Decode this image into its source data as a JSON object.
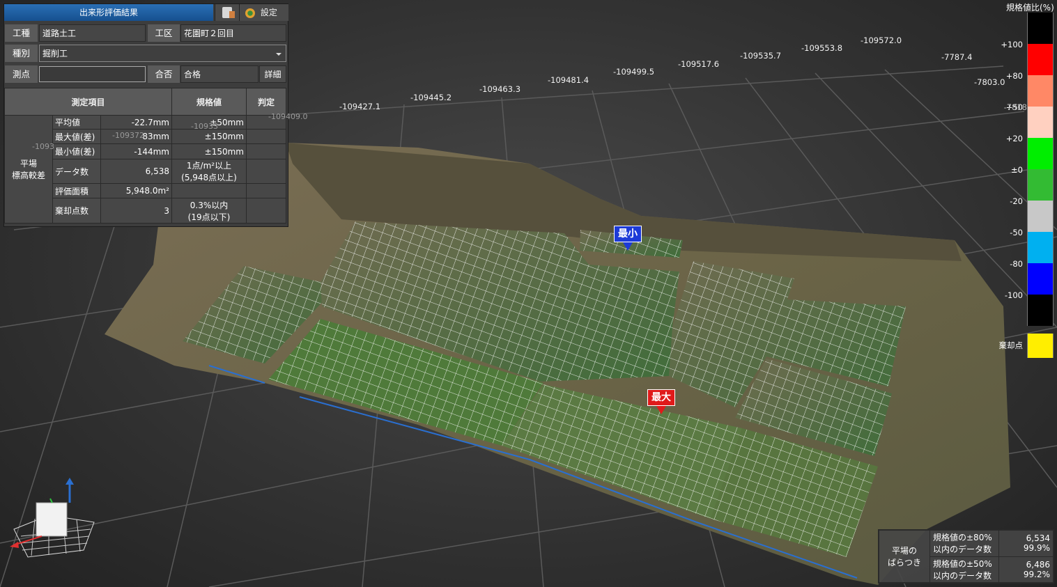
{
  "panel": {
    "title": "出来形評価結果",
    "settings_label": "設定",
    "clipboard_icon": "clipboard-icon",
    "settings_icon": "gear-icon",
    "work_type_label": "工種",
    "work_type_value": "道路土工",
    "section_label": "工区",
    "section_value": "花園町２回目",
    "category_label": "種別",
    "category_value": "掘削工",
    "point_label": "測点",
    "point_value": "",
    "pass_label": "合否",
    "pass_value": "合格",
    "detail_label": "詳細",
    "table_headers": {
      "item": "測定項目",
      "spec": "規格値",
      "judge": "判定"
    },
    "group_label_1": "平場",
    "group_label_2": "標高較差",
    "rows": [
      {
        "label": "平均値",
        "value": "-22.7mm",
        "spec": "±50mm",
        "judge": ""
      },
      {
        "label": "最大値(差)",
        "value": "83mm",
        "spec": "±150mm",
        "judge": ""
      },
      {
        "label": "最小値(差)",
        "value": "-144mm",
        "spec": "±150mm",
        "judge": ""
      },
      {
        "label": "データ数",
        "value": "6,538",
        "spec": "1点/m²以上",
        "spec2": "(5,948点以上)",
        "judge": ""
      },
      {
        "label": "評価面積",
        "value": "5,948.0m²",
        "spec": "",
        "judge": ""
      },
      {
        "label": "棄却点数",
        "value": "3",
        "spec": "0.3%以内",
        "spec2": "(19点以下)",
        "judge": ""
      }
    ],
    "ghost_coords": [
      "-109372",
      "-10933",
      "-109409.0",
      "-1093"
    ]
  },
  "coords_x": [
    "-109427.1",
    "-109445.2",
    "-109463.3",
    "-109481.4",
    "-109499.5",
    "-109517.6",
    "-109535.7",
    "-109553.8",
    "-109572.0"
  ],
  "coords_y": [
    "-7787.4",
    "-7803.0"
  ],
  "markers": {
    "min": "最小",
    "max": "最大"
  },
  "scale": {
    "title": "規格値比(%)",
    "ticks": [
      "+100",
      "+80",
      "+50",
      "+20",
      "±0",
      "-20",
      "-50",
      "-80",
      "-100"
    ],
    "ghost_tick": "-7818",
    "colors": [
      "#000000",
      "#ff0000",
      "#ff8866",
      "#ffd0c0",
      "#00ee00",
      "#33bb33",
      "#c8c8c8",
      "#00b0f0",
      "#0000ff",
      "#000000"
    ],
    "reject_label": "棄却点",
    "reject_color": "#ffee00"
  },
  "stats": {
    "label": "平場の\nばらつき",
    "rows": [
      {
        "desc1": "規格値の±80%",
        "desc2": "以内のデータ数",
        "count": "6,534",
        "pct": "99.9%"
      },
      {
        "desc1": "規格値の±50%",
        "desc2": "以内のデータ数",
        "count": "6,486",
        "pct": "99.2%"
      }
    ]
  },
  "axes": {
    "x": "X",
    "y": "Y",
    "z": "Z"
  }
}
